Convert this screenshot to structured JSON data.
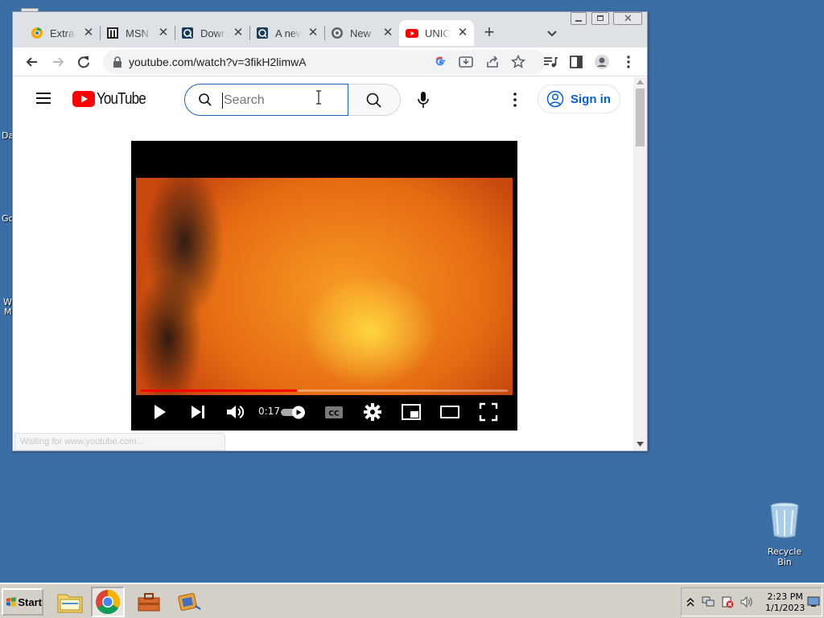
{
  "desktop": {
    "left_labels": [
      "Da",
      "Go",
      "W",
      "M"
    ],
    "recycle_bin_label": "Recycle Bin"
  },
  "browser": {
    "tabs": [
      {
        "title": "Extrac",
        "icon": "chrome-canary-icon",
        "active": false
      },
      {
        "title": "MSN",
        "icon": "msn-icon",
        "active": false
      },
      {
        "title": "Down",
        "icon": "document-icon",
        "active": false
      },
      {
        "title": "A new",
        "icon": "document-icon",
        "active": false
      },
      {
        "title": "New",
        "icon": "globe-icon",
        "active": false
      },
      {
        "title": "UNIC",
        "icon": "youtube-icon",
        "active": true
      }
    ],
    "url": "youtube.com/watch?v=3fikH2limwA",
    "status_text": "Waiting for www.youtube.com..."
  },
  "youtube": {
    "logo_text": "YouTube",
    "search_placeholder": "Search",
    "signin_label": "Sign in",
    "player": {
      "time": "0:17",
      "progress_fraction": 0.425,
      "accent_color": "#ff0000"
    }
  },
  "taskbar": {
    "start_label": "Start",
    "clock_time": "2:23 PM",
    "clock_date": "1/1/2023"
  },
  "colors": {
    "desktop": "#3b6ea5",
    "youtube_red": "#ff0000",
    "link_blue": "#065fd4"
  }
}
